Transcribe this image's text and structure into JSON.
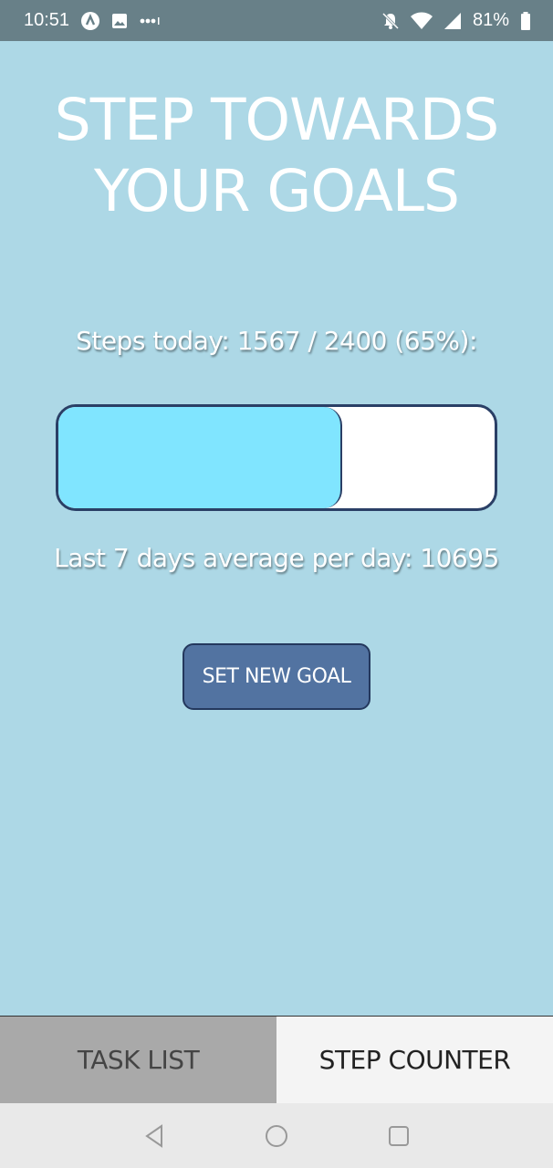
{
  "status_bar": {
    "time": "10:51",
    "battery": "81%",
    "icons_left": [
      "app-notification-icon",
      "image-icon",
      "more-dots-icon"
    ],
    "icons_right": [
      "bell-off-icon",
      "wifi-icon",
      "signal-icon",
      "battery-icon"
    ]
  },
  "page": {
    "title_line1": "STEP TOWARDS",
    "title_line2": "YOUR GOALS",
    "steps_today_text": "Steps today: 1567 / 2400 (65%):",
    "progress": {
      "current": 1567,
      "goal": 2400,
      "fraction": 0.65
    },
    "average_text": "Last 7 days average per day: 10695",
    "set_goal_label": "SET NEW GOAL"
  },
  "tabs": [
    {
      "label": "TASK LIST",
      "active": false
    },
    {
      "label": "STEP COUNTER",
      "active": true
    }
  ],
  "nav": [
    "back-icon",
    "home-icon",
    "recents-icon"
  ],
  "colors": {
    "background": "#add8e6",
    "status_bar": "#688088",
    "progress_fill": "#80e5ff",
    "progress_border": "#2a3f66",
    "button": "#5273a1"
  }
}
